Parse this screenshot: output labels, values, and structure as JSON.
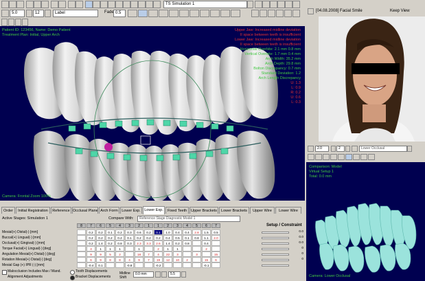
{
  "toolbar": {
    "row1_buttons": [
      "new",
      "open",
      "save",
      "cut",
      "copy",
      "paste",
      "undo",
      "redo",
      "measure",
      "settings"
    ],
    "zoom_value": "5.0",
    "step_value": "12",
    "label_value": "Label",
    "fade_label": "Fade",
    "fade_value": "0.5",
    "sim_title": "TS Simulation 1"
  },
  "overlay": {
    "top_left": [
      "Patient ID: 123456, Name: Demo Patient",
      "Treatment Plan: Initial, Upper Arch"
    ],
    "top_right_red": [
      "Upper Jaw: Increased midline deviation",
      "II space between teeth is insufficient",
      "Lower Jaw: Increased midline deviation",
      "II space between teeth is insufficient"
    ],
    "mid_right_green": [
      "Horizontal Overbite: 2.1 mm  0.8 mm",
      "Vertical Overbite: 1.7 mm  0.4 mm",
      "Arch Width: 35.2 mm",
      "Arch Depth: 29.8 mm",
      "Bolton Discrepancy: 0.7 mm",
      "Standard Deviation: 1.2",
      "Arch Length Discrepancy"
    ],
    "right_values": [
      "U: 1.3",
      "L: 0.9",
      "R: 0.2",
      "U: 0.6",
      "L: 0.3"
    ],
    "bottom_left": "Camera: Frontal  Zoom 100%"
  },
  "tabs": {
    "items": [
      "Order",
      "Initial Registration",
      "Reference",
      "Occlusal Plane",
      "Arch Form",
      "Lower Exp.",
      "Lower Exp.",
      "Fixed Teeth",
      "Upper Brackets",
      "Lower Brackets",
      "Upper Wire",
      "Lower Wire"
    ],
    "active_index": 6
  },
  "table": {
    "title": "Active Stages: Simulation 1",
    "compare_label": "Compare With:",
    "compare_value": "Reference Stage Diagnostic Model 1",
    "setup_header": "Setup / Constraint",
    "columns": [
      "8",
      "7",
      "6",
      "5",
      "4",
      "3",
      "2",
      "1",
      "1",
      "2",
      "3",
      "4",
      "5",
      "6",
      "7"
    ],
    "rows": [
      {
        "label": "Mesial(+) Distal(-) [mm]",
        "cells": [
          "",
          "0.2",
          "0.2",
          "0.1",
          "0.2",
          "0.3",
          "0.6",
          "0.2",
          "0.1",
          "1.0",
          "0.4",
          "0.4",
          "2.8",
          "1.5",
          "0.5"
        ],
        "value": "0.0"
      },
      {
        "label": "Buccal(+) Lingual(-) [mm]",
        "cells": [
          "",
          "0.2",
          "0.2",
          "0.2",
          "0.2",
          "0.1",
          "0.2",
          "0.2",
          "0.2",
          "0.4",
          "0.5",
          "0.1",
          "0.8",
          "1.1",
          "2.0"
        ],
        "value": "0.0"
      },
      {
        "label": "Occlusal(+) Gingival(-) [mm]",
        "cells": [
          "",
          "0.2",
          "1.4",
          "0.2",
          "0.8",
          "0.3",
          "2.3",
          "3.3",
          "2.6",
          "1.4",
          "0.2",
          "0.8",
          "",
          "0.4",
          ""
        ],
        "value": "0.0"
      },
      {
        "label": "Torque Facial(+) Lingual(-) [deg]",
        "cells": [
          "",
          "4",
          "1",
          "1",
          "1",
          "",
          "1",
          "",
          "2",
          "1",
          "1",
          "",
          "",
          "2",
          ""
        ],
        "value": "0"
      },
      {
        "label": "Angulation Mesial(+) Distal(-) [deg]",
        "cells": [
          "",
          "9",
          "9",
          "5",
          "2",
          "",
          "18",
          "7",
          "4",
          "22",
          "3",
          "",
          "3",
          "",
          "15"
        ],
        "value": "0"
      },
      {
        "label": "Rotation Mesial(+) Distal(-) [deg]",
        "cells": [
          "",
          "6",
          "9",
          "8",
          "8",
          "4",
          "9",
          "7",
          "19",
          "12",
          "10",
          "2",
          "",
          "15",
          "6"
        ],
        "value": "0"
      },
      {
        "label": "Mesial Gap (+) IPR (-) [mm]",
        "cells": [
          "",
          "-0.4",
          "0.1",
          "",
          "",
          "-0.8",
          "",
          "",
          "-0.2",
          "",
          "",
          "",
          "",
          "-0.1",
          ""
        ],
        "value": ""
      }
    ],
    "bottom_options": {
      "malocclusion": "Malocclusion Includes Max / Mand.",
      "alignment": "Alignment Adjustments",
      "tooth_displacements": "Tooth Displacements",
      "bracket_displacements": "Bracket Displacements",
      "midline_label": "Midline Shift",
      "midline_value": "0.0 mm",
      "step_value": "5.5"
    }
  },
  "photo_panel": {
    "date_label": "[04.08.2008] Facial Smile",
    "keep_view": "Keep View"
  },
  "mini_view": {
    "zoom_value": "2.0",
    "step_value": "2",
    "view_value": "Lower Occlusal",
    "overlay_lines": [
      "Comparison: Model",
      "Virtual Setup 1",
      "Total: 0.0 mm"
    ],
    "bottom_label": "Camera: Lower Occlusal"
  },
  "colors": {
    "viewport_bg": "#000050",
    "teeth": "#dcdcdc",
    "brackets": "#4ed6a8",
    "mini_teeth": "#9be3dc"
  }
}
